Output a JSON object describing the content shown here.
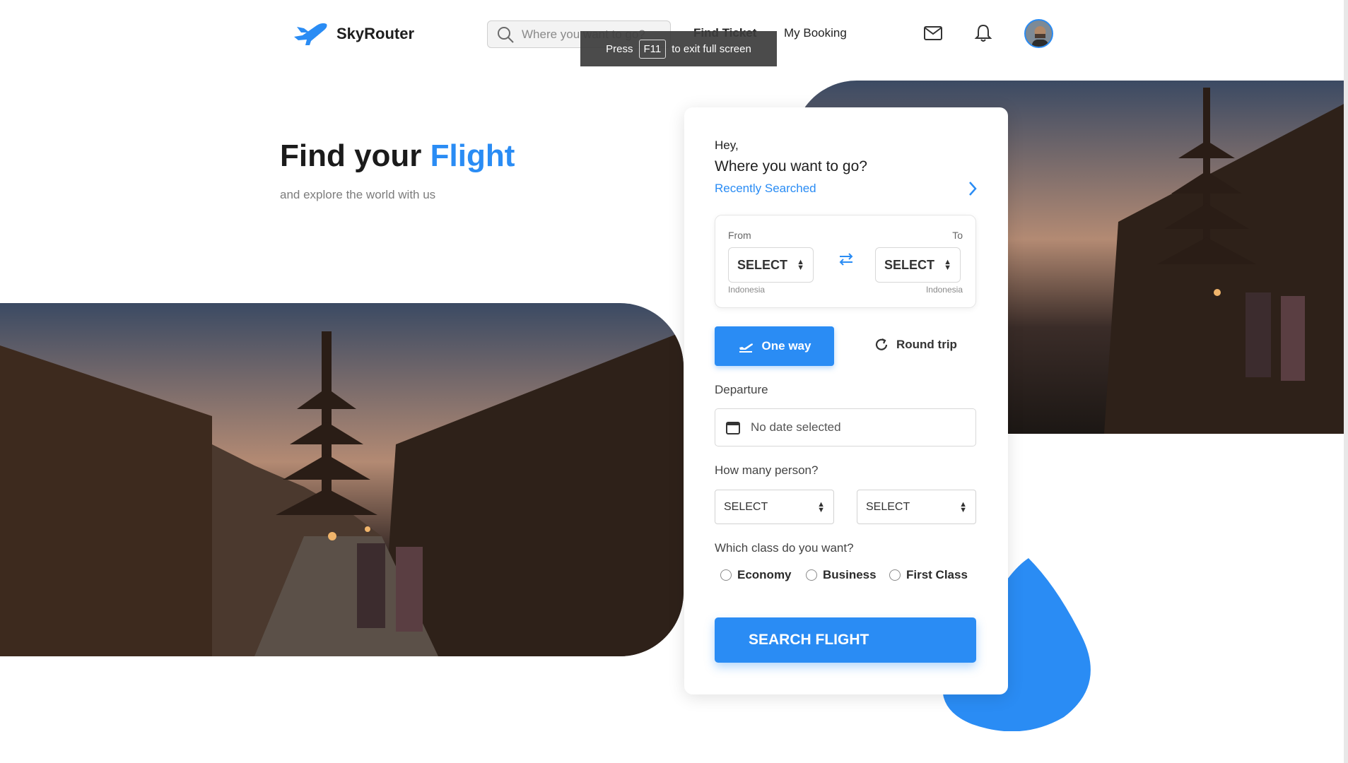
{
  "header": {
    "brand": "SkyRouter",
    "search_placeholder": "Where you want to go?",
    "nav": {
      "find_ticket": "Find Ticket",
      "my_booking": "My Booking"
    }
  },
  "toast": {
    "press": "Press",
    "key": "F11",
    "message": "to exit full screen"
  },
  "hero": {
    "title_prefix": "Find your",
    "title_accent": "Flight",
    "subtitle": "and explore the world with us"
  },
  "form": {
    "greeting": "Hey,",
    "question": "Where you want to go?",
    "recently_searched": "Recently Searched",
    "from_label": "From",
    "to_label": "To",
    "from_value": "SELECT",
    "to_value": "SELECT",
    "from_country": "Indonesia",
    "to_country": "Indonesia",
    "trip_one_way": "One way",
    "trip_round": "Round trip",
    "departure_label": "Departure",
    "departure_value": "No date selected",
    "persons_label": "How many person?",
    "persons_select_1": "SELECT",
    "persons_select_2": "SELECT",
    "class_label": "Which class do you want?",
    "classes": [
      "Economy",
      "Business",
      "First Class"
    ],
    "search_button": "SEARCH FLIGHT"
  },
  "colors": {
    "accent": "#2a8cf4",
    "text": "#1f1f1f",
    "muted": "#7c7c7c"
  },
  "icons": [
    "plane-logo-icon",
    "search-icon",
    "mail-icon",
    "bell-icon",
    "chevron-right-icon",
    "swap-icon",
    "plane-takeoff-icon",
    "refresh-icon",
    "calendar-icon"
  ]
}
